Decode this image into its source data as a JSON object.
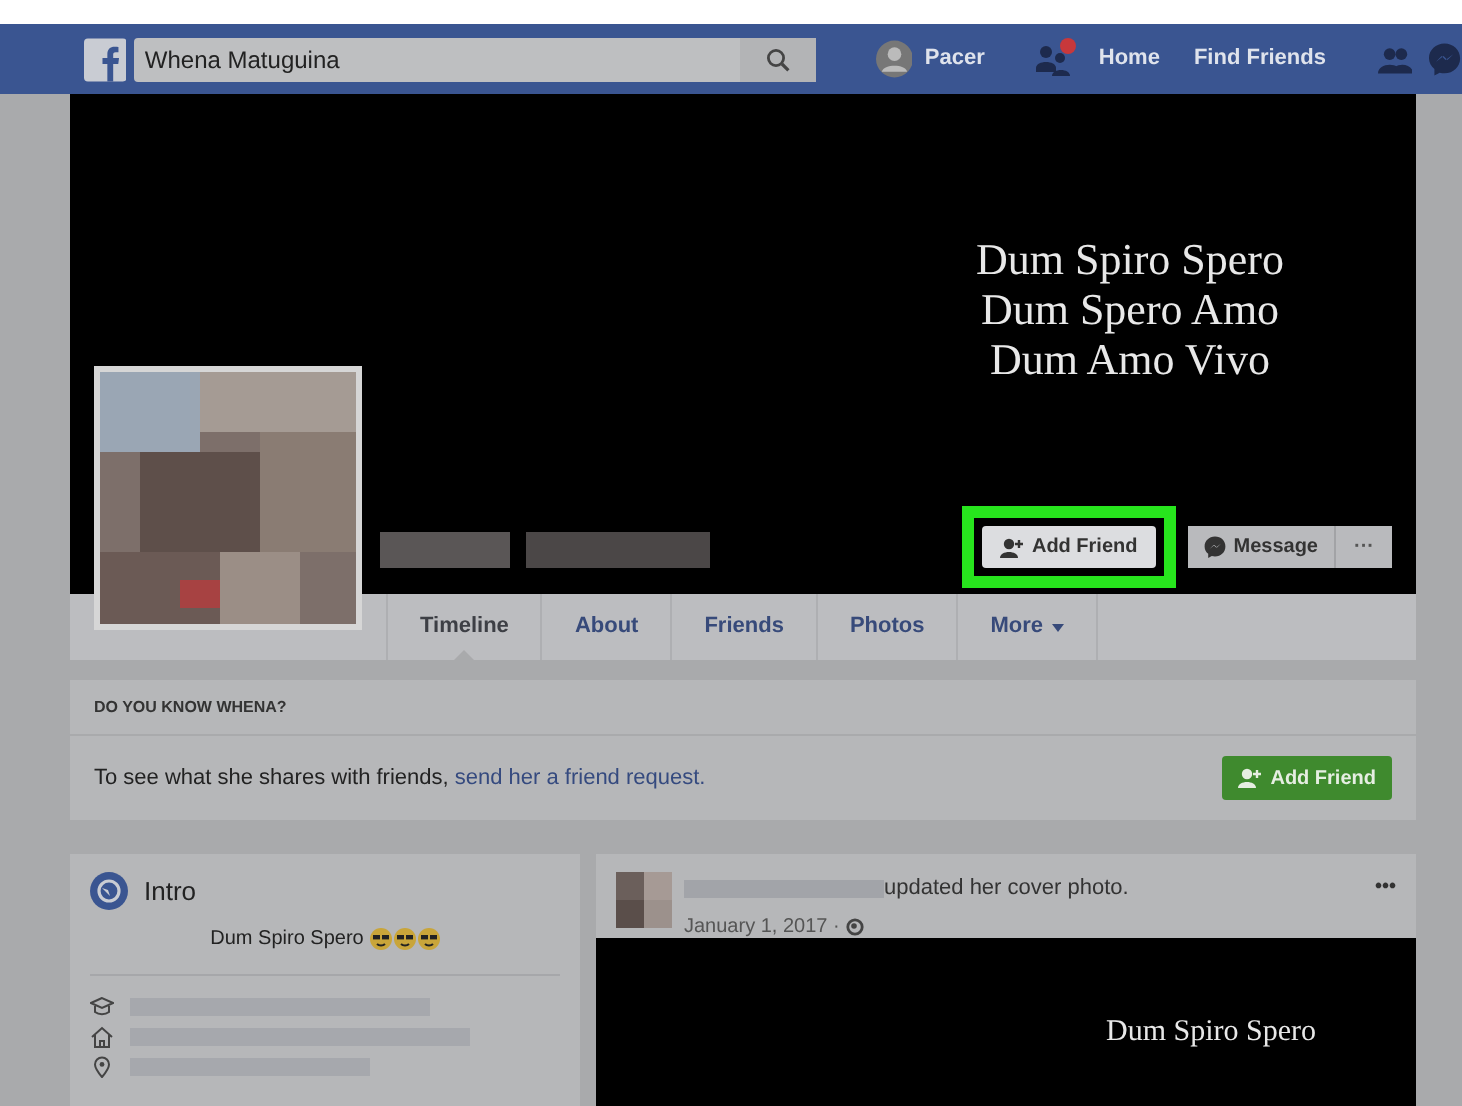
{
  "nav": {
    "search": {
      "value": "Whena Matuguina"
    },
    "profile_name": "Pacer",
    "notification_dot": true,
    "links": [
      "Home",
      "Find Friends"
    ]
  },
  "cover": {
    "quote_lines": [
      "Dum Spiro Spero",
      "Dum Spero Amo",
      "Dum Amo Vivo"
    ],
    "actions": [
      {
        "kind": "add-friend",
        "label": "Add Friend",
        "highlighted": true
      },
      {
        "kind": "message",
        "label": "Message",
        "highlighted": false
      },
      {
        "kind": "more",
        "label": "···",
        "highlighted": false
      }
    ]
  },
  "tabs": [
    {
      "label": "Timeline",
      "selected": true,
      "dropdown": false
    },
    {
      "label": "About",
      "selected": false,
      "dropdown": false
    },
    {
      "label": "Friends",
      "selected": false,
      "dropdown": false
    },
    {
      "label": "Photos",
      "selected": false,
      "dropdown": false
    },
    {
      "label": "More",
      "selected": false,
      "dropdown": true
    }
  ],
  "know_card": {
    "heading": "DO YOU KNOW WHENA?",
    "text": "To see what she shares with friends, ",
    "link": "send her a friend request.",
    "button": "Add Friend"
  },
  "intro": {
    "title": "Intro",
    "bio": "Dum Spiro Spero",
    "details": [
      {
        "kind": "education"
      },
      {
        "kind": "home"
      },
      {
        "kind": "location"
      }
    ]
  },
  "post": {
    "action": "updated her cover photo.",
    "date": "January 1, 2017 ·",
    "menu": "•••",
    "cover_lines": [
      "Dum Spiro Spero"
    ]
  }
}
